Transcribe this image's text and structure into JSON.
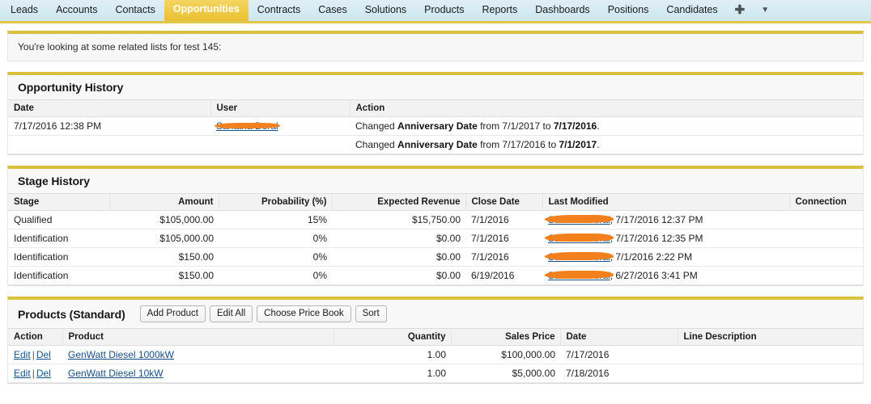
{
  "tabbar": {
    "tabs": [
      {
        "label": "Leads",
        "active": false
      },
      {
        "label": "Accounts",
        "active": false
      },
      {
        "label": "Contacts",
        "active": false
      },
      {
        "label": "Opportunities",
        "active": true
      },
      {
        "label": "Contracts",
        "active": false
      },
      {
        "label": "Cases",
        "active": false
      },
      {
        "label": "Solutions",
        "active": false
      },
      {
        "label": "Products",
        "active": false
      },
      {
        "label": "Reports",
        "active": false
      },
      {
        "label": "Dashboards",
        "active": false
      },
      {
        "label": "Positions",
        "active": false
      },
      {
        "label": "Candidates",
        "active": false
      }
    ],
    "add_tab_icon": "plus-icon",
    "add_tab_glyph": "✚",
    "more_tabs_icon": "chevron-down-icon",
    "more_tabs_glyph": "▼",
    "accent_color": "#e0c94a",
    "active_tab_color": "#efc944"
  },
  "message": {
    "text": "You're looking at some related lists for test 145:"
  },
  "opportunity_history": {
    "title": "Opportunity History",
    "columns": [
      "Date",
      "User",
      "Action"
    ],
    "rows": [
      {
        "date": "7/17/2016 12:38 PM",
        "user": "Santana Doral",
        "user_redacted": true,
        "action_prefix": "Changed ",
        "action_field": "Anniversary Date",
        "action_mid": " from 7/1/2017 to ",
        "action_to": "7/17/2016",
        "action_suffix": "."
      },
      {
        "date": "",
        "user": "",
        "user_redacted": false,
        "action_prefix": "Changed ",
        "action_field": "Anniversary Date",
        "action_mid": " from 7/17/2016 to ",
        "action_to": "7/1/2017",
        "action_suffix": "."
      }
    ]
  },
  "stage_history": {
    "title": "Stage History",
    "columns": [
      "Stage",
      "Amount",
      "Probability (%)",
      "Expected Revenue",
      "Close Date",
      "Last Modified",
      "Connection"
    ],
    "rows": [
      {
        "stage": "Qualified",
        "amount": "$105,000.00",
        "probability": "15%",
        "expected_revenue": "$15,750.00",
        "close_date": "7/1/2016",
        "modified_by": "Santana Doral",
        "modified_at": ", 7/17/2016 12:37 PM",
        "connection": ""
      },
      {
        "stage": "Identification",
        "amount": "$105,000.00",
        "probability": "0%",
        "expected_revenue": "$0.00",
        "close_date": "7/1/2016",
        "modified_by": "Santana Doral",
        "modified_at": ", 7/17/2016 12:35 PM",
        "connection": ""
      },
      {
        "stage": "Identification",
        "amount": "$150.00",
        "probability": "0%",
        "expected_revenue": "$0.00",
        "close_date": "7/1/2016",
        "modified_by": "Santana Doral",
        "modified_at": ", 7/1/2016 2:22 PM",
        "connection": ""
      },
      {
        "stage": "Identification",
        "amount": "$150.00",
        "probability": "0%",
        "expected_revenue": "$0.00",
        "close_date": "6/19/2016",
        "modified_by": "Santana Doral",
        "modified_at": ", 6/27/2016 3:41 PM",
        "connection": ""
      }
    ]
  },
  "products": {
    "title": "Products (Standard)",
    "buttons": [
      {
        "label": "Add Product",
        "name": "add-product-button"
      },
      {
        "label": "Edit All",
        "name": "edit-all-button"
      },
      {
        "label": "Choose Price Book",
        "name": "choose-price-book-button"
      },
      {
        "label": "Sort",
        "name": "sort-button"
      }
    ],
    "columns": [
      "Action",
      "Product",
      "Quantity",
      "Sales Price",
      "Date",
      "Line Description"
    ],
    "action_edit": "Edit",
    "action_del": "Del",
    "action_sep": "|",
    "rows": [
      {
        "product": "GenWatt Diesel 1000kW",
        "quantity": "1.00",
        "sales_price": "$100,000.00",
        "date": "7/17/2016",
        "line_description": ""
      },
      {
        "product": "GenWatt Diesel 10kW",
        "quantity": "1.00",
        "sales_price": "$5,000.00",
        "date": "7/18/2016",
        "line_description": ""
      }
    ]
  }
}
